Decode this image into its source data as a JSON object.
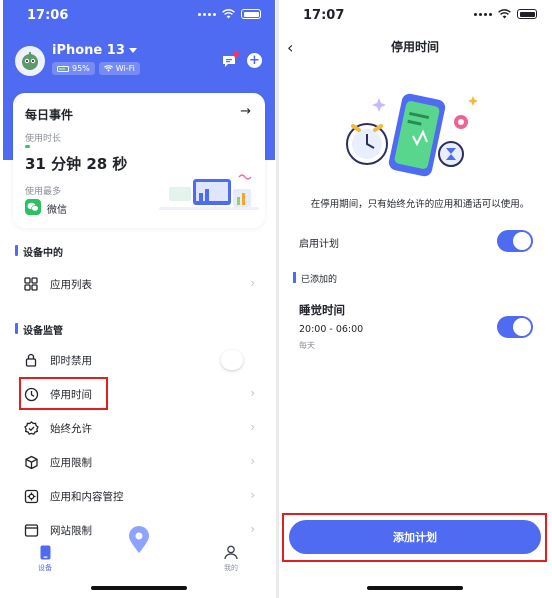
{
  "colors": {
    "accent": "#4f6bf2",
    "highlight": "#e02020",
    "wechat": "#2bc160",
    "progress": "#34c759"
  },
  "left": {
    "status_time": "17:06",
    "device": {
      "name": "iPhone 13",
      "battery": "95%",
      "network": "Wi-Fi"
    },
    "daily": {
      "title": "每日事件",
      "usage_label": "使用时长",
      "usage_time": "31 分钟 28 秒",
      "most_used_label": "使用最多",
      "most_used_app": "微信"
    },
    "sections": {
      "device": "设备中的",
      "monitor": "设备监管"
    },
    "device_items": [
      {
        "label": "应用列表",
        "icon": "grid-icon"
      }
    ],
    "monitor_items": [
      {
        "label": "即时禁用",
        "icon": "lock-icon"
      },
      {
        "label": "停用时间",
        "icon": "clock-icon"
      },
      {
        "label": "始终允许",
        "icon": "check-badge-icon"
      },
      {
        "label": "应用限制",
        "icon": "cube-icon"
      },
      {
        "label": "应用和内容管控",
        "icon": "gear-icon"
      },
      {
        "label": "网站限制",
        "icon": "browser-icon"
      }
    ],
    "tabs": [
      {
        "label": "设备",
        "icon": "phone-icon",
        "active": true
      },
      {
        "label": "我的",
        "icon": "person-icon",
        "active": false
      }
    ]
  },
  "right": {
    "status_time": "17:07",
    "title": "停用时间",
    "description": "在停用期间，只有始终允许的应用和通话可以使用。",
    "enable_label": "启用计划",
    "enabled": true,
    "added_label": "已添加的",
    "plan": {
      "name": "睡觉时间",
      "time": "20:00 - 06:00",
      "repeat": "每天",
      "enabled": true
    },
    "add_button": "添加计划"
  }
}
